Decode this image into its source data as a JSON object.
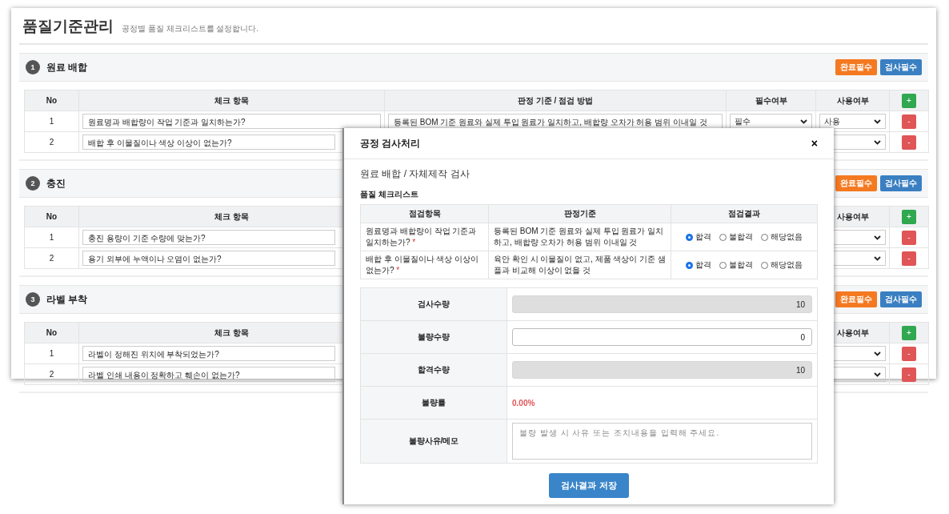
{
  "page": {
    "title": "품질기준관리",
    "subtitle": "공정별 품질 체크리스트를 설정합니다."
  },
  "sections": [
    {
      "number": "1",
      "title": "원료 배합",
      "buttons": [
        {
          "label": "완료필수",
          "color": "#f47920"
        },
        {
          "label": "검사필수",
          "color": "#3a7fc1"
        }
      ],
      "header": {
        "no": "No",
        "item": "체크 항목",
        "criterion": "판정 기준 / 점검 방법",
        "required": "필수여부",
        "use": "사용여부"
      },
      "add_button": "+",
      "rows": [
        {
          "no": "1",
          "item": "원료명과 배합량이 작업 기준과 일치하는가?",
          "criterion": "등록된 BOM 기준 원료와 실제 투입 원료가 일치하고, 배합량 오차가 허용 범위 이내일 것",
          "required": "필수",
          "use": "사용",
          "delete_button": "-"
        },
        {
          "no": "2",
          "item": "배합 후 이물질이나 색상 이상이 없는가?",
          "delete_button": "-"
        }
      ]
    },
    {
      "number": "2",
      "title": "충진",
      "buttons": [
        {
          "label": "완료필수",
          "color": "#f47920"
        },
        {
          "label": "검사필수",
          "color": "#3a7fc1"
        }
      ],
      "header": {
        "no": "No",
        "item": "체크 항목",
        "use": "사용여부"
      },
      "add_button": "+",
      "rows": [
        {
          "no": "1",
          "item": "충진 용량이 기준 수량에 맞는가?",
          "delete_button": "-"
        },
        {
          "no": "2",
          "item": "용기 외부에 누액이나 오염이 없는가?",
          "delete_button": "-"
        }
      ]
    },
    {
      "number": "3",
      "title": "라벨 부착",
      "buttons": [
        {
          "label": "완료필수",
          "color": "#f47920"
        },
        {
          "label": "검사필수",
          "color": "#3a7fc1"
        }
      ],
      "header": {
        "no": "No",
        "item": "체크 항목",
        "use": "사용여부"
      },
      "add_button": "+",
      "rows": [
        {
          "no": "1",
          "item": "라벨이 정해진 위치에 부착되었는가?",
          "delete_button": "-"
        },
        {
          "no": "2",
          "item": "라벨 인쇄 내용이 정확하고 훼손이 없는가?",
          "delete_button": "-"
        }
      ]
    }
  ],
  "modal": {
    "title": "공정 검사처리",
    "close": "×",
    "subtitle": "원료 배합 / 자체제작 검사",
    "checklist_title": "품질 체크리스트",
    "checklist_columns": [
      "점검항목",
      "판정기준",
      "점검결과"
    ],
    "checklist_rows": [
      {
        "item": "원료명과 배합량이 작업 기준과 일치하는가?",
        "mark": "*",
        "criterion": "등록된 BOM 기준 원료와 실제 투입 원료가 일치하고, 배합량 오차가 허용 범위 이내일 것",
        "options": [
          {
            "label": "합격",
            "selected": true
          },
          {
            "label": "불합격",
            "selected": false
          },
          {
            "label": "해당없음",
            "selected": false
          }
        ]
      },
      {
        "item": "배합 후 이물질이나 색상 이상이 없는가?",
        "mark": "*",
        "criterion": "육안 확인 시 이물질이 없고, 제품 색상이 기준 샘플과 비교해 이상이 없을 것",
        "options": [
          {
            "label": "합격",
            "selected": true
          },
          {
            "label": "불합격",
            "selected": false
          },
          {
            "label": "해당없음",
            "selected": false
          }
        ]
      }
    ],
    "fields": [
      {
        "label": "검사수량",
        "kind": "readonly",
        "value": "10"
      },
      {
        "label": "불량수량",
        "kind": "input",
        "value": "0"
      },
      {
        "label": "합격수량",
        "kind": "readonly",
        "value": "10"
      },
      {
        "label": "불량률",
        "kind": "text",
        "value": "0.00%"
      },
      {
        "label": "불량사유/메모",
        "kind": "textarea",
        "placeholder": "불량 발생 시 사유 또는 조치내용을 입력해 주세요."
      }
    ],
    "save_button": "검사결과 저장"
  }
}
